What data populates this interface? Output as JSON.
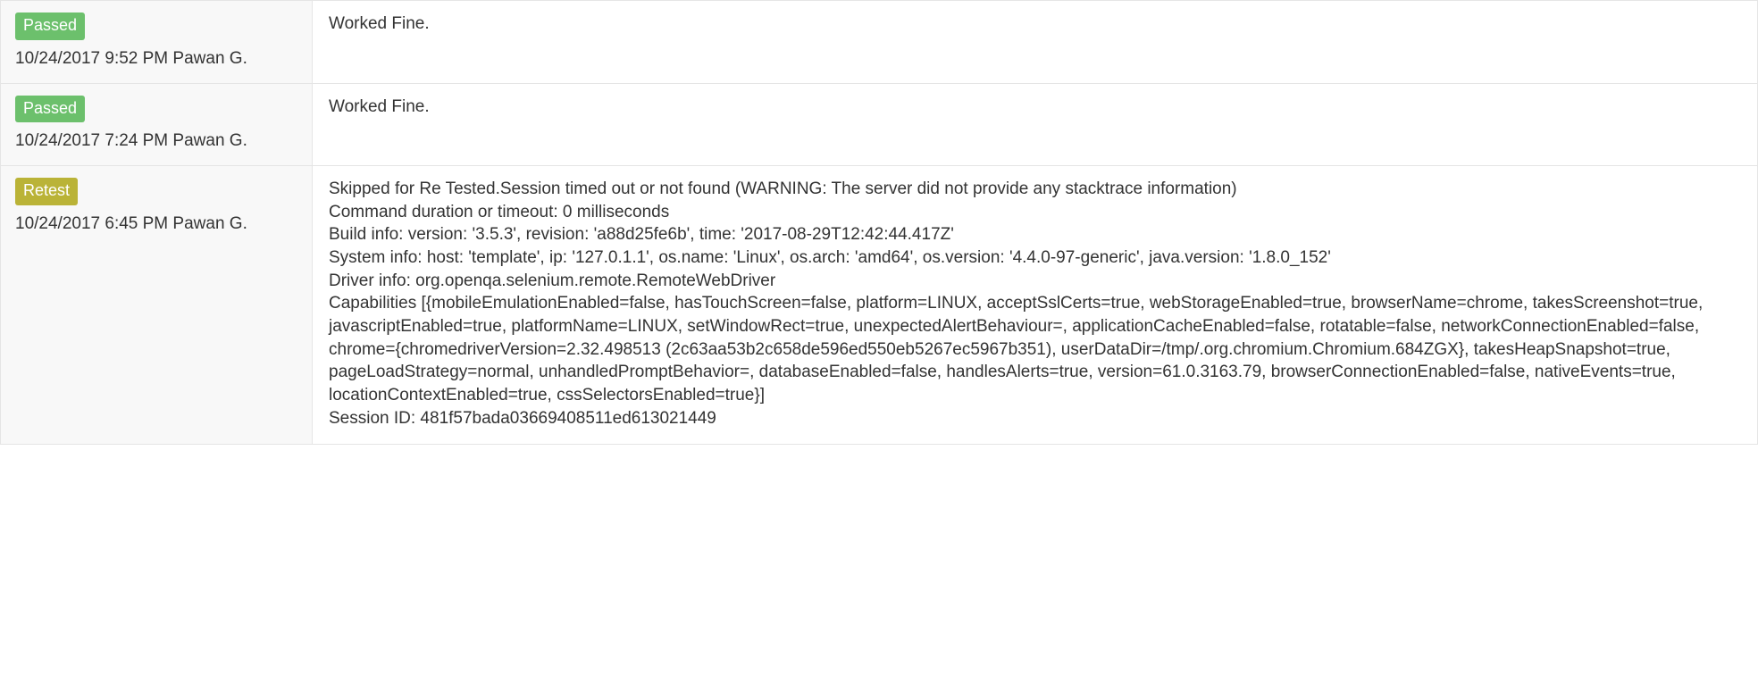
{
  "status_colors": {
    "Passed": "#6cc06c",
    "Retest": "#bab337"
  },
  "rows": [
    {
      "status": "Passed",
      "timestamp": "10/24/2017 9:52 PM",
      "author": "Pawan G.",
      "message": "Worked Fine."
    },
    {
      "status": "Passed",
      "timestamp": "10/24/2017 7:24 PM",
      "author": "Pawan G.",
      "message": "Worked Fine."
    },
    {
      "status": "Retest",
      "timestamp": "10/24/2017 6:45 PM",
      "author": "Pawan G.",
      "message": "Skipped for Re Tested.Session timed out or not found (WARNING: The server did not provide any stacktrace information)\nCommand duration or timeout: 0 milliseconds\nBuild info: version: '3.5.3', revision: 'a88d25fe6b', time: '2017-08-29T12:42:44.417Z'\nSystem info: host: 'template', ip: '127.0.1.1', os.name: 'Linux', os.arch: 'amd64', os.version: '4.4.0-97-generic', java.version: '1.8.0_152'\nDriver info: org.openqa.selenium.remote.RemoteWebDriver\nCapabilities [{mobileEmulationEnabled=false, hasTouchScreen=false, platform=LINUX, acceptSslCerts=true, webStorageEnabled=true, browserName=chrome, takesScreenshot=true, javascriptEnabled=true, platformName=LINUX, setWindowRect=true, unexpectedAlertBehaviour=, applicationCacheEnabled=false, rotatable=false, networkConnectionEnabled=false, chrome={chromedriverVersion=2.32.498513 (2c63aa53b2c658de596ed550eb5267ec5967b351), userDataDir=/tmp/.org.chromium.Chromium.684ZGX}, takesHeapSnapshot=true, pageLoadStrategy=normal, unhandledPromptBehavior=, databaseEnabled=false, handlesAlerts=true, version=61.0.3163.79, browserConnectionEnabled=false, nativeEvents=true, locationContextEnabled=true, cssSelectorsEnabled=true}]\nSession ID: 481f57bada03669408511ed613021449"
    }
  ]
}
